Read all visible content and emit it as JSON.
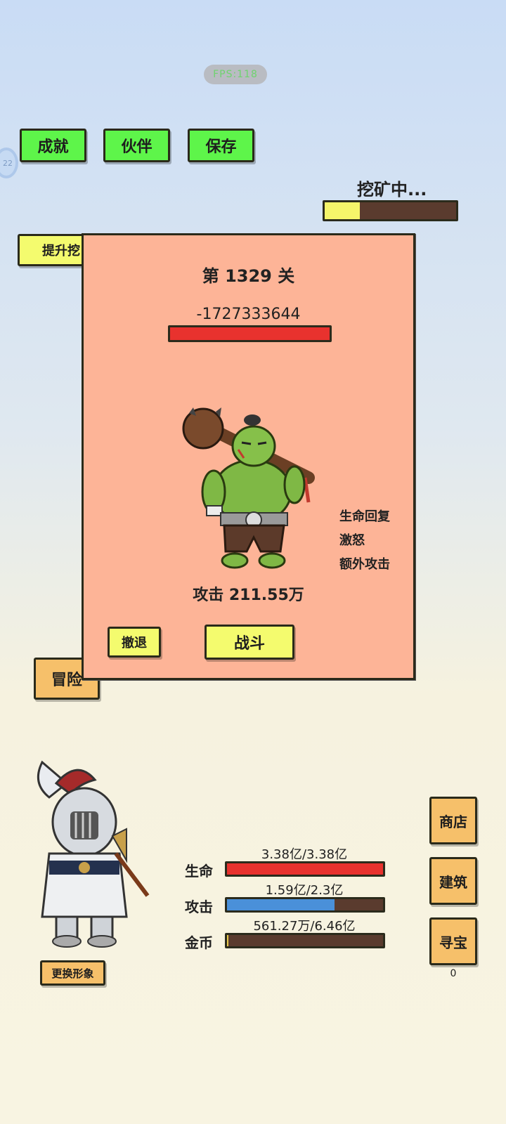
{
  "status_pill": "FPS:118",
  "side_tab_text": "22",
  "top_buttons": [
    {
      "label": "成就"
    },
    {
      "label": "伙伴"
    },
    {
      "label": "保存"
    }
  ],
  "mining": {
    "label": "挖矿中...",
    "progress": 0.27,
    "fill_color": "#f5f56a",
    "bg_color": "#5a3b2e"
  },
  "upgrade_button": "提升挖",
  "adventure_button": "冒险",
  "battle": {
    "stage": "第 1329 关",
    "enemy_hp_text": "-1727333644",
    "enemy_hp_fraction": 1.0,
    "enemy_icon": "orc-warrior",
    "attack_text": "攻击 211.55万",
    "traits": [
      "生命回复",
      "激怒",
      "额外攻击"
    ],
    "retreat_button": "撤退",
    "fight_button": "战斗"
  },
  "player": {
    "avatar_icon": "armored-knight",
    "change_look_button": "更换形象",
    "stats": [
      {
        "label": "生命",
        "value_text": "3.38亿/3.38亿",
        "fraction": 1.0,
        "color": "#e8322e"
      },
      {
        "label": "攻击",
        "value_text": "1.59亿/2.3亿",
        "fraction": 0.69,
        "color": "#4a90d9"
      },
      {
        "label": "金币",
        "value_text": "561.27万/6.46亿",
        "fraction": 0.009,
        "color": "#e8c84a"
      }
    ]
  },
  "right_menu": [
    {
      "label": "商店"
    },
    {
      "label": "建筑"
    },
    {
      "label": "寻宝"
    }
  ],
  "treasure_count": "0",
  "colors": {
    "green_button": "#5ef54a",
    "yellow_button": "#f4fb6e",
    "orange_button": "#f6c06a",
    "modal_bg": "#fdb497"
  }
}
